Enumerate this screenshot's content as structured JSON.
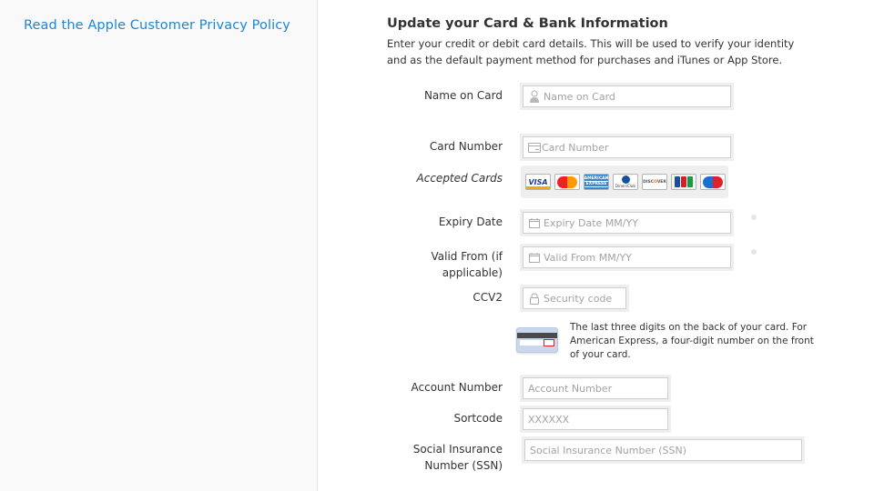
{
  "sidebar": {
    "privacy_link": "Read the Apple Customer Privacy Policy"
  },
  "header": {
    "title": "Update your Card & Bank Information",
    "description": "Enter your credit or debit card details. This will be used to verify your identity and as the default payment method for purchases and iTunes or App Store."
  },
  "form": {
    "name_on_card": {
      "label": "Name on Card",
      "placeholder": "Name on Card",
      "value": "",
      "icon": "person-icon"
    },
    "card_number": {
      "label": "Card Number",
      "placeholder": "Card Number",
      "value": "",
      "icon": "credit-card-icon"
    },
    "accepted_cards": {
      "label": "Accepted Cards",
      "cards": [
        "VISA",
        "MasterCard",
        "American Express",
        "Diners Club",
        "Discover",
        "JCB",
        "Maestro"
      ]
    },
    "expiry_date": {
      "label": "Expiry Date",
      "placeholder": "Expiry Date MM/YY",
      "value": "",
      "icon": "calendar-icon"
    },
    "valid_from": {
      "label": "Valid From (if applicable)",
      "placeholder": "Valid From MM/YY",
      "value": "",
      "icon": "calendar-icon"
    },
    "ccv2": {
      "label": "CCV2",
      "placeholder": "Security code",
      "value": "",
      "icon": "lock-icon"
    },
    "ccv_hint": "The last three digits on the back of your card. For American Express, a four-digit number on the front of your card.",
    "account_number": {
      "label": "Account Number",
      "placeholder": "Account Number",
      "value": ""
    },
    "sortcode": {
      "label": "Sortcode",
      "placeholder": "XXXXXX",
      "value": ""
    },
    "ssn": {
      "label": "Social Insurance Number (SSN)",
      "placeholder": "Social Insurance Number (SSN)",
      "value": ""
    }
  },
  "colors": {
    "link": "#1f86d4",
    "sidebar_bg": "#f9f9f9",
    "text": "#333333",
    "placeholder": "#a2a2a2"
  }
}
